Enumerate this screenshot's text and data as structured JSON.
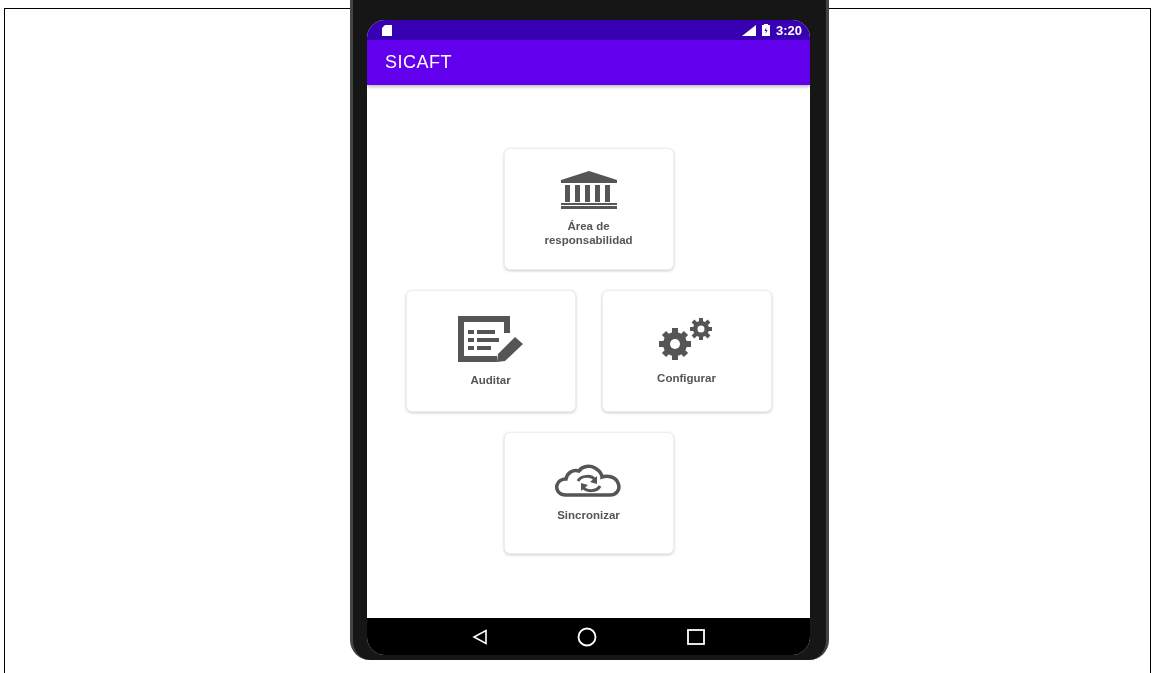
{
  "status_bar": {
    "time": "3:20"
  },
  "app_bar": {
    "title": "SICAFT"
  },
  "menu_tiles": [
    {
      "kind": "building",
      "label": "Área de responsabilidad"
    },
    {
      "kind": "audit",
      "label": "Auditar"
    },
    {
      "kind": "settings",
      "label": "Configurar"
    },
    {
      "kind": "sync",
      "label": "Sincronizar"
    }
  ]
}
